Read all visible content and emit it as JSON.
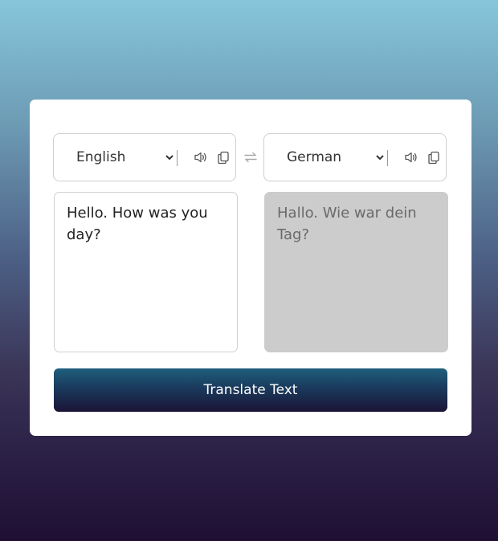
{
  "from": {
    "language": "English",
    "text": "Hello. How was you day?"
  },
  "to": {
    "language": "German",
    "placeholder": "Hallo. Wie war dein Tag?"
  },
  "icons": {
    "speak": "speaker-icon",
    "copy": "copy-icon",
    "exchange": "exchange-icon"
  },
  "translate_button": {
    "label": "Translate Text"
  },
  "colors": {
    "button_top": "#1f5f7c",
    "button_bottom": "#1b1436",
    "output_bg": "#cccccc",
    "border": "#cfcfcf"
  }
}
